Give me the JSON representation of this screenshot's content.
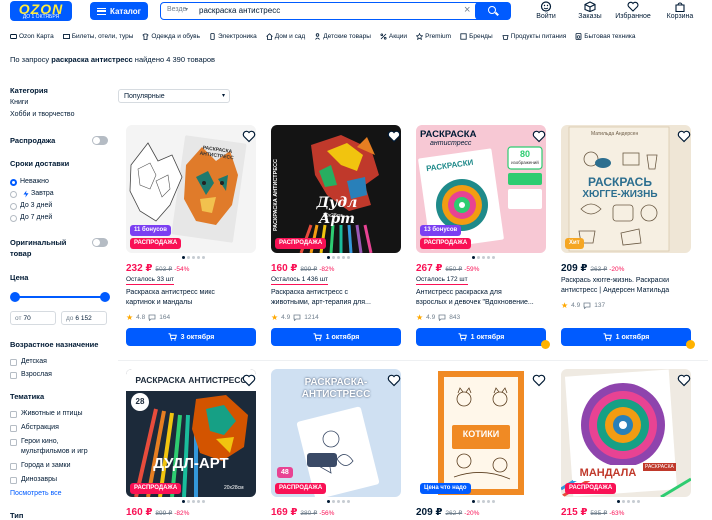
{
  "header": {
    "logo": "OZON",
    "logo_sub": "ДО 1 ОКТЯБРЯ",
    "catalog": "Каталог",
    "search_scope": "Везде",
    "search_query": "раскраска антистресс",
    "items": [
      "Войти",
      "Заказы",
      "Избранное",
      "Корзина"
    ]
  },
  "nav": [
    "Ozon Карта",
    "Билеты, отели, туры",
    "Одежда и обувь",
    "Электроника",
    "Дом и сад",
    "Детские товары",
    "Акции",
    "Premium",
    "Бренды",
    "Продукты питания",
    "Бытовая техника"
  ],
  "results": {
    "prefix": "По запросу",
    "query": "раскраска антистресс",
    "suffix": "найдено 4 390 товаров"
  },
  "sort": {
    "selected": "Популярные"
  },
  "sidebar": {
    "category_title": "Категория",
    "categories": [
      "Книги",
      "Хобби и творчество"
    ],
    "sale_title": "Распродажа",
    "delivery_title": "Сроки доставки",
    "delivery": [
      "Неважно",
      "Завтра",
      "До 3 дней",
      "До 7 дней"
    ],
    "original_title_1": "Оригинальный",
    "original_title_2": "товар",
    "price_title": "Цена",
    "price_from_label": "от",
    "price_from": "70",
    "price_to_label": "до",
    "price_to": "6 152",
    "age_title": "Возрастное назначение",
    "ages": [
      "Детская",
      "Взрослая"
    ],
    "theme_title": "Тематика",
    "themes": [
      "Животные и птицы",
      "Абстракция",
      "Герои кино,",
      "мультфильмов и игр",
      "Города и замки",
      "Динозавры"
    ],
    "show_all": "Посмотреть все",
    "type_title": "Тип"
  },
  "products": [
    {
      "price": "232 ₽",
      "old": "503 ₽",
      "disc": "-54%",
      "left": "Осталось 33 шт",
      "name1": "Раскраска антистресс микс",
      "name2": "картинок и мандалы",
      "rating": "4.8",
      "reviews": "164",
      "cart": "3 октября",
      "badge1": "11 бонусов",
      "badge2": "РАСПРОДАЖА",
      "img_title": "РАСКРАСКА АНТИСТРЕСС"
    },
    {
      "price": "160 ₽",
      "old": "899 ₽",
      "disc": "-82%",
      "left": "Осталось 1 436 шт",
      "name1": "Раскраска антистресс с",
      "name2": "животными, арт-терапия для...",
      "rating": "4.9",
      "reviews": "1214",
      "cart": "1 октября",
      "badge2": "РАСПРОДАЖА",
      "img_title": "Дудл Арт",
      "img_side": "РАСКРАСКА АНТИСТРЕСС",
      "img_size": "20х28см"
    },
    {
      "price": "267 ₽",
      "old": "650 ₽",
      "disc": "-59%",
      "left": "Осталось 172 шт",
      "name1": "Антистресс раскраска для",
      "name2": "взрослых и девочек \"Вдохновение...",
      "rating": "4.9",
      "reviews": "843",
      "cart": "1 октября",
      "badge1": "13 бонусов",
      "badge2": "РАСПРОДАЖА",
      "img_title": "РАСКРАСКА",
      "img_title2": "антистресс",
      "img_title3": "РАСКРАСКИ",
      "img_80": "80",
      "img_80_sub": "изображений"
    },
    {
      "price": "209 ₽",
      "old": "263 ₽",
      "disc": "-20%",
      "name1": "Раскрась хюгге-жизнь. Раскраски",
      "name2": "антистресс | Андерсен Матильда",
      "rating": "4.9",
      "reviews": "137",
      "cart": "1 октября",
      "badge1": "Хит",
      "img_author": "Матильда Андерсен",
      "img_title": "РАСКРАСЬ",
      "img_title2": "ХЮГГЕ-ЖИЗНЬ"
    },
    {
      "price": "160 ₽",
      "old": "899 ₽",
      "disc": "-82%",
      "badge2": "РАСПРОДАЖА",
      "img_title": "РАСКРАСКА АНТИСТРЕСС",
      "img_num": "28",
      "img_big": "ДУДЛ-АРТ",
      "img_size": "20х28см"
    },
    {
      "price": "169 ₽",
      "old": "380 ₽",
      "disc": "-56%",
      "badge1": "48",
      "badge2": "РАСПРОДАЖА",
      "img_title": "РАСКРАСКА-",
      "img_title2": "АНТИСТРЕСС"
    },
    {
      "price": "209 ₽",
      "old": "262 ₽",
      "disc": "-20%",
      "badge1": "Цена что надо",
      "img_title": "КОТИКИ"
    },
    {
      "price": "215 ₽",
      "old": "585 ₽",
      "disc": "-63%",
      "badge2": "РАСПРОДАЖА",
      "img_title": "МАНДАЛА",
      "img_tag": "РАСКРАСКА"
    }
  ],
  "colors": {
    "accent": "#005bff",
    "sale": "#f91155",
    "bonus": "#7b3ff2",
    "hit": "#f5a623",
    "text": "#001a34",
    "muted": "#707f8d"
  }
}
